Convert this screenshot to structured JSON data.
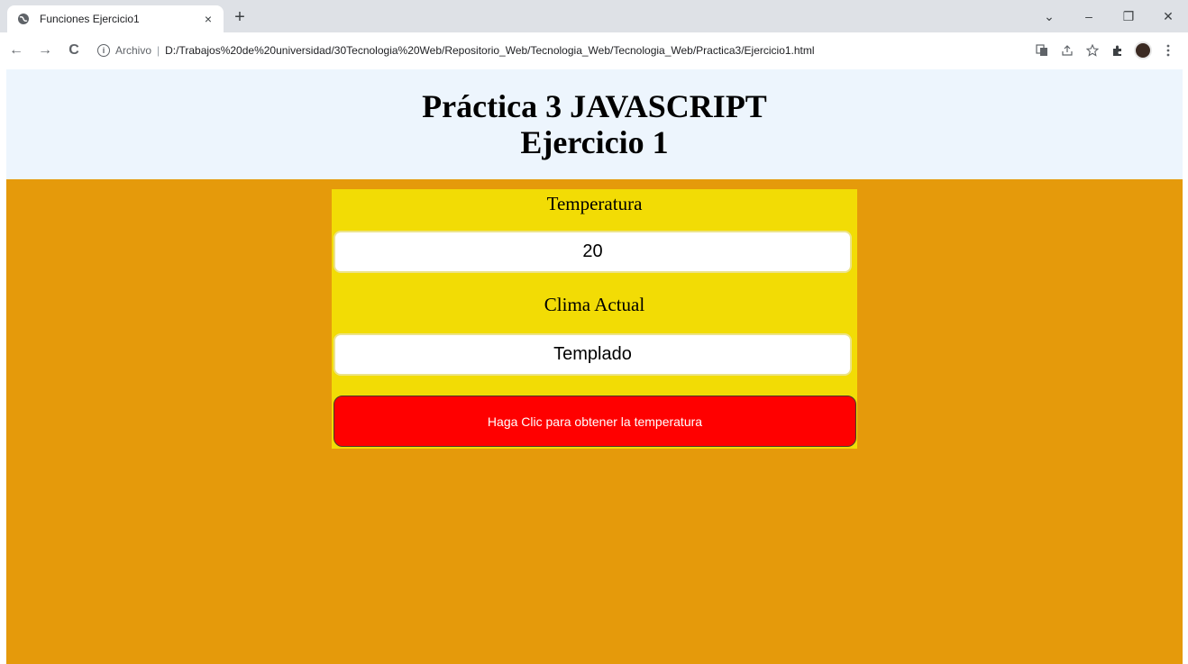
{
  "browser": {
    "tab_title": "Funciones Ejercicio1",
    "tab_close": "×",
    "new_tab": "+",
    "scheme_label": "Archivo",
    "separator": "|",
    "url": "D:/Trabajos%20de%20universidad/30Tecnologia%20Web/Repositorio_Web/Tecnologia_Web/Tecnologia_Web/Practica3/Ejercicio1.html",
    "window_controls": {
      "dropdown": "⌄",
      "minimize": "–",
      "restore": "❐",
      "close": "✕"
    },
    "nav": {
      "back": "←",
      "forward": "→",
      "reload": "C"
    },
    "toolbar_icons": [
      "translate-icon",
      "share-icon",
      "star-icon",
      "extensions-icon",
      "profile-avatar",
      "menu-icon"
    ]
  },
  "page": {
    "title_line1": "Práctica 3 JAVASCRIPT",
    "title_line2": "Ejercicio 1",
    "temperature_label": "Temperatura",
    "temperature_value": "20",
    "climate_label": "Clima Actual",
    "climate_value": "Templado",
    "button_label": "Haga Clic para obtener la temperatura"
  },
  "colors": {
    "page_background": "#e59a0b",
    "header_background": "#edf5fd",
    "panel_background": "#f2dc05",
    "button_background": "#ff0000",
    "button_text": "#ffffff"
  }
}
